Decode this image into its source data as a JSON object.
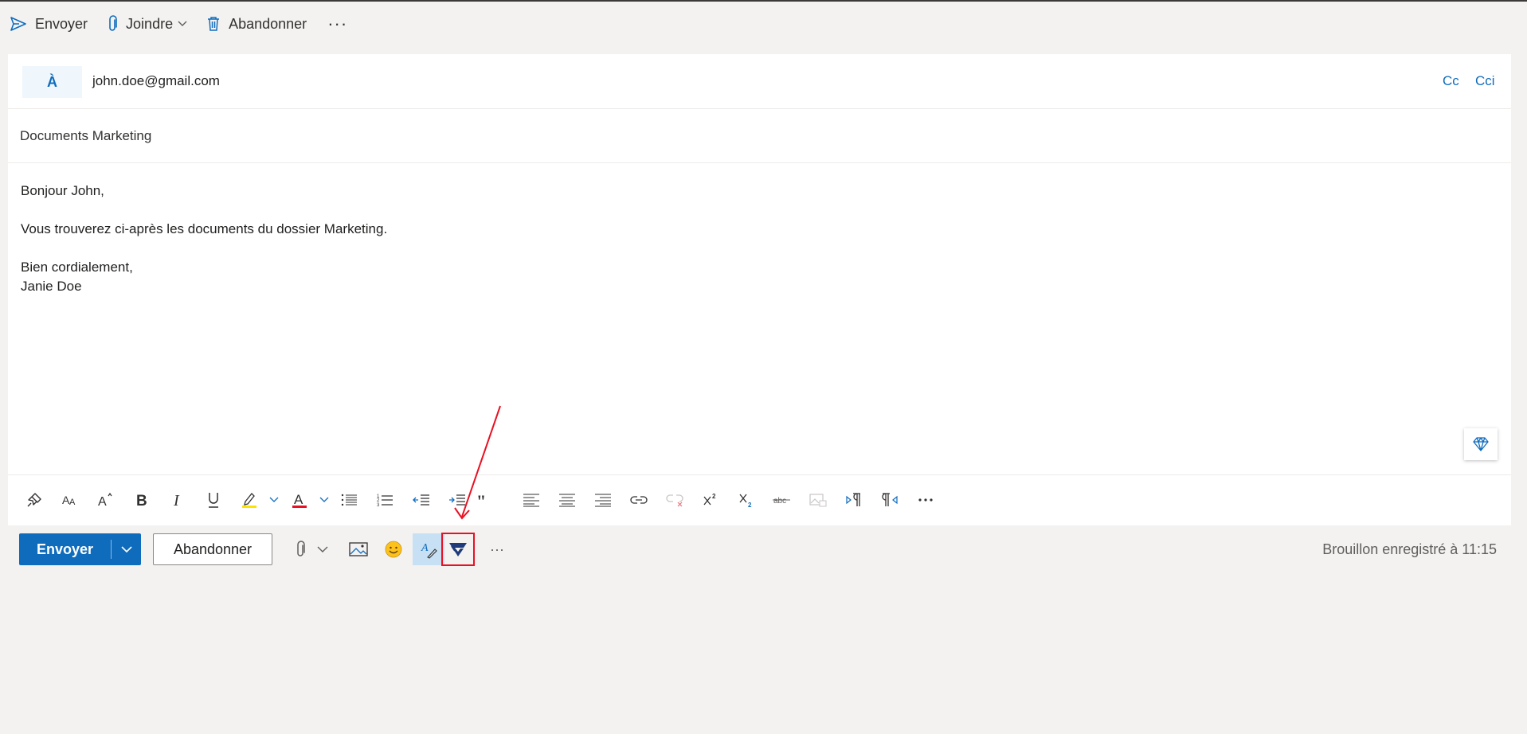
{
  "command_bar": {
    "send_label": "Envoyer",
    "attach_label": "Joindre",
    "discard_label": "Abandonner",
    "more_label": "···"
  },
  "recipients": {
    "to_label": "À",
    "to_value": "john.doe@gmail.com",
    "cc_label": "Cc",
    "bcc_label": "Cci"
  },
  "subject": "Documents Marketing",
  "body": {
    "greeting": "Bonjour John,",
    "line": "Vous trouverez ci-après les documents du dossier Marketing.",
    "closing": "Bien cordialement,",
    "signature": "Janie Doe"
  },
  "format_toolbar": {
    "icons": [
      "format-painter-icon",
      "font-size-icon",
      "grow-font-icon",
      "bold-icon",
      "italic-icon",
      "underline-icon",
      "highlight-icon",
      "font-color-icon",
      "bullets-icon",
      "numbering-icon",
      "decrease-indent-icon",
      "increase-indent-icon",
      "quote-icon",
      "align-left-icon",
      "align-center-icon",
      "align-right-icon",
      "link-icon",
      "unlink-icon",
      "superscript-icon",
      "subscript-icon",
      "strikethrough-icon",
      "picture-inline-icon",
      "ltr-icon",
      "rtl-icon",
      "more-icon"
    ]
  },
  "action_bar": {
    "send_label": "Envoyer",
    "discard_label": "Abandonner",
    "more_label": "···",
    "status": "Brouillon enregistré à 11:15"
  },
  "colors": {
    "accent": "#0f6cbd",
    "highlight_marker": "#fde300",
    "font_color_marker": "#e81123",
    "annotation_red": "#e81123"
  }
}
